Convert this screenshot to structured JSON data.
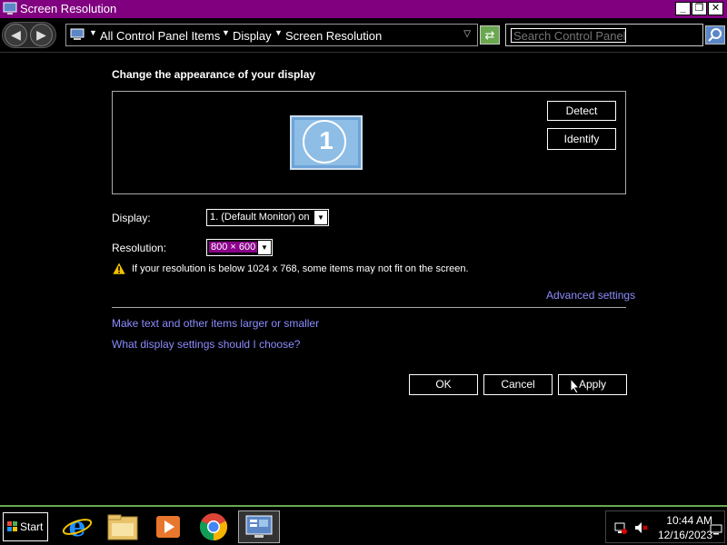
{
  "window": {
    "title": "Screen Resolution",
    "minimize_glyph": "_",
    "restore_glyph": "❐",
    "close_glyph": "✕"
  },
  "address": {
    "breadcrumbs": [
      "All Control Panel Items",
      "Display",
      "Screen Resolution"
    ],
    "search_placeholder": "Search Control Panel"
  },
  "main": {
    "heading": "Change the appearance of your display",
    "monitor_number": "1",
    "detect_label": "Detect",
    "identify_label": "Identify",
    "display_label": "Display:",
    "display_value": "1. (Default Monitor) on",
    "resolution_label": "Resolution:",
    "resolution_value": "800 × 600",
    "warning_text": "If your resolution is below 1024 x 768, some items may not fit on the screen.",
    "advanced_link": "Advanced settings",
    "link_text_size": "Make text and other items larger or smaller",
    "link_which_settings": "What display settings should I choose?",
    "ok_label": "OK",
    "cancel_label": "Cancel",
    "apply_label": "Apply"
  },
  "taskbar": {
    "start_label": "Start",
    "apps": [
      "internet-explorer",
      "file-explorer",
      "media-player",
      "chrome",
      "control-panel-display"
    ],
    "clock_time": "10:44 AM",
    "clock_date": "12/16/2023"
  },
  "colors": {
    "titlebar": "#800080",
    "link": "#8c8cff",
    "taskbar_accent": "#6aa84f",
    "selection": "#8b008b"
  }
}
